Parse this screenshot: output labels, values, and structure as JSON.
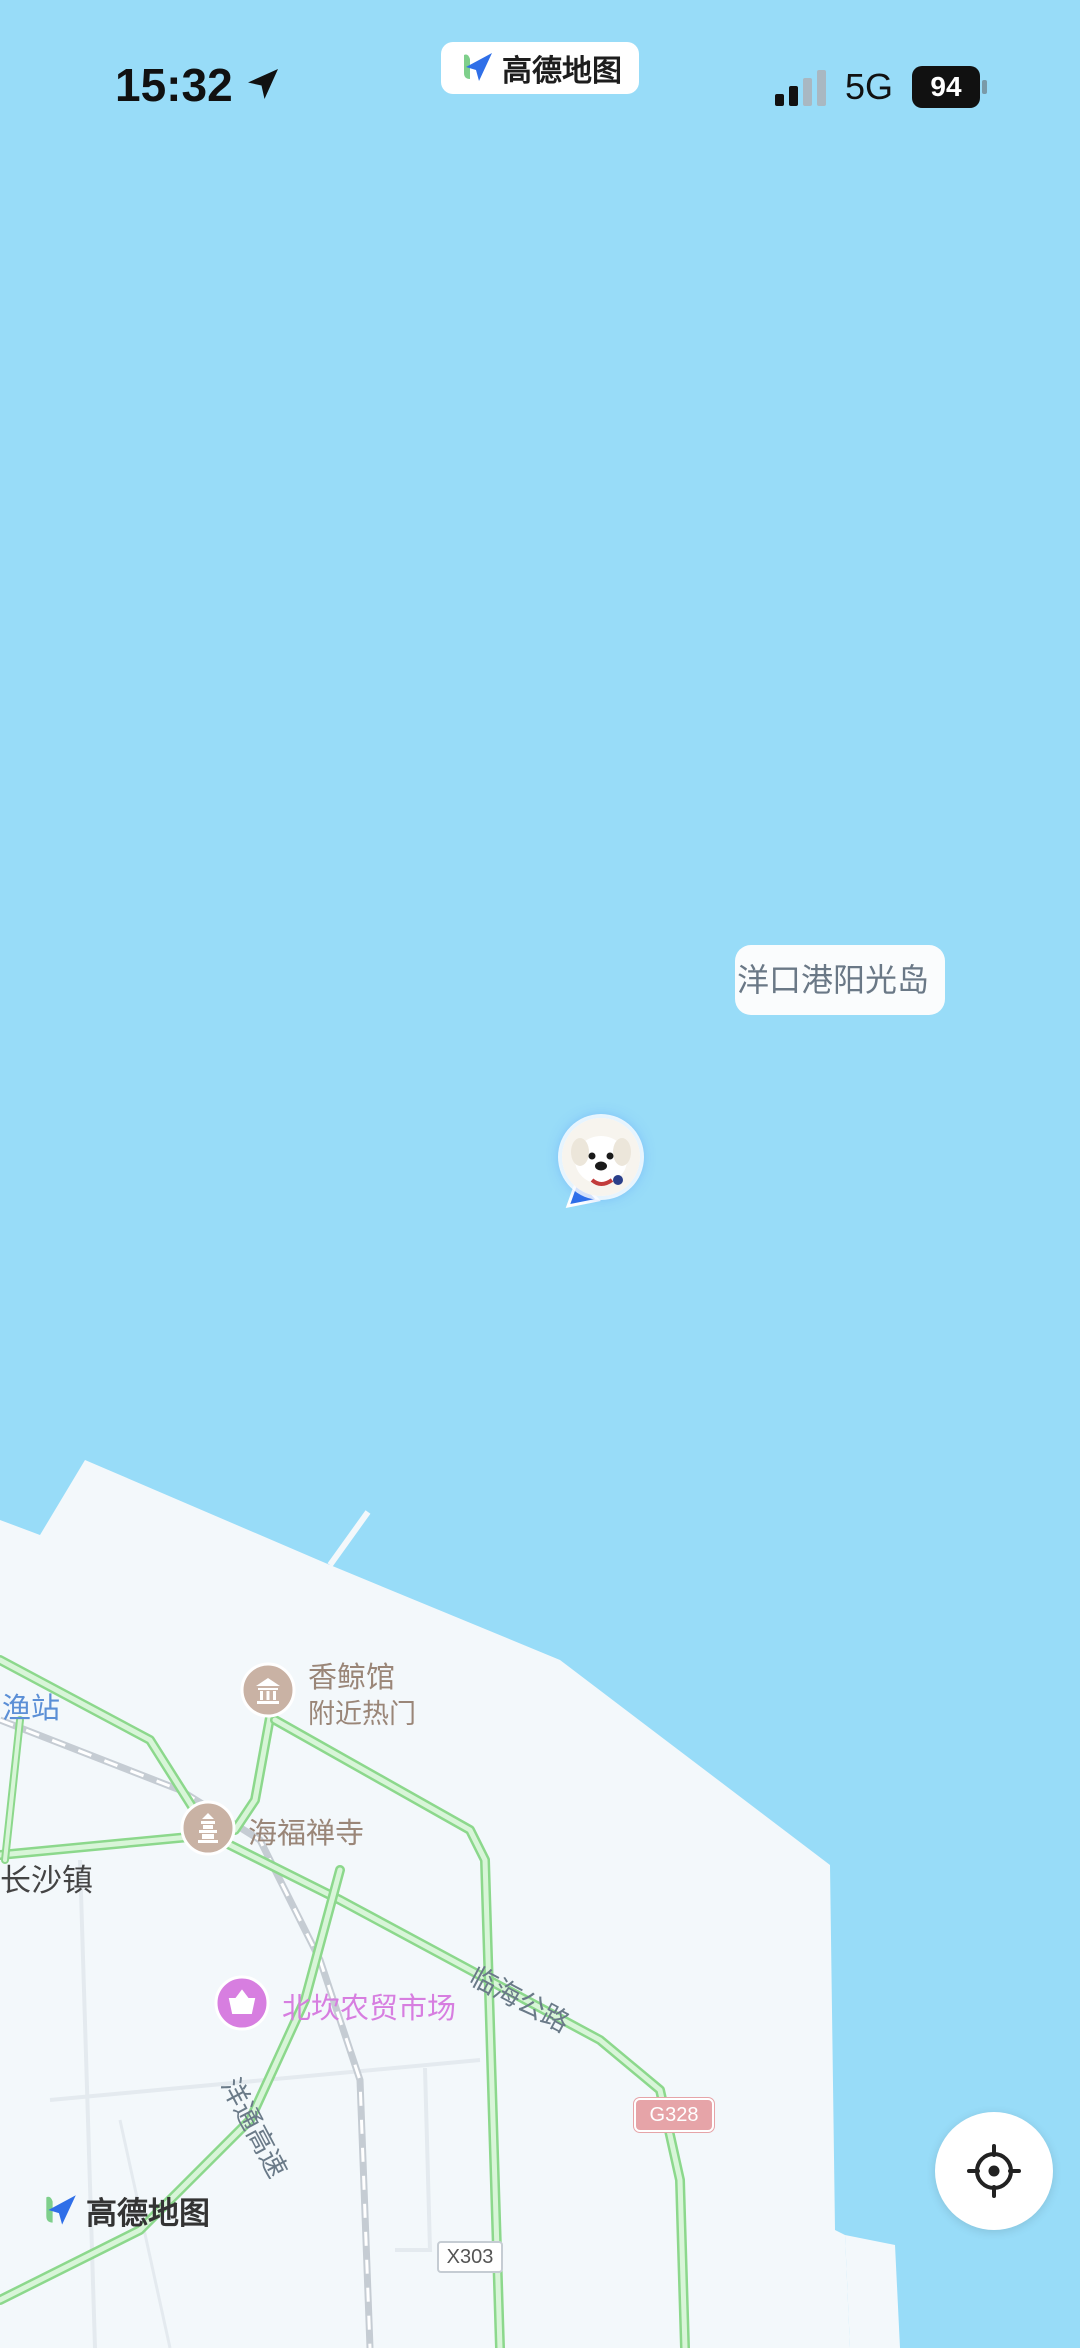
{
  "status_bar": {
    "time": "15:32",
    "network": "5G",
    "battery": "94",
    "location_icon": "location-arrow-icon",
    "signal_icon": "signal-bars-icon"
  },
  "app_badge": {
    "name": "高德地图",
    "icon": "amap-logo-icon"
  },
  "map": {
    "labels": {
      "island": "洋口港阳光岛",
      "fish_station": "渔站",
      "changsha_town": "长沙镇",
      "xiangjing_hall": "香鲸馆",
      "xiangjing_hall_sub": "附近热门",
      "haifu_temple": "海福禅寺",
      "beikan_market": "北坎农贸市场",
      "linhai_road": "临海公路",
      "yangtong_expressway": "洋通高速",
      "g328": "G328",
      "x303": "X303"
    },
    "colors": {
      "water": "#98dcf8",
      "land": "#f3f8fb",
      "road_green": "#a8e6a8",
      "poi_brown": "#c9b2a4",
      "poi_purple": "#d77ee0"
    }
  },
  "controls": {
    "locate_button_icon": "crosshair-locate-icon"
  },
  "watermark": {
    "name": "高德地图"
  }
}
